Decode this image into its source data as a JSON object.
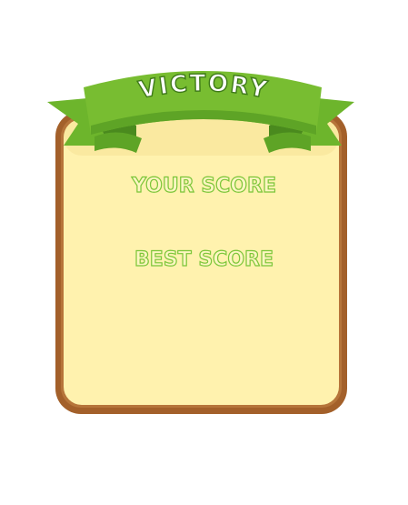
{
  "dialog": {
    "title": "VICTORY",
    "your_score_label": "YOUR SCORE",
    "best_score_label": "BEST SCORE"
  },
  "colors": {
    "panel_fill": "#fff2ae",
    "panel_border": "#a3602a",
    "ribbon_green": "#6db52c",
    "ribbon_dark": "#4a8a1e",
    "ribbon_banner": "#78bd31",
    "title_text": "#ffffff",
    "score_text_fill": "#fff6c2",
    "score_text_outline": "#7cc63a"
  }
}
